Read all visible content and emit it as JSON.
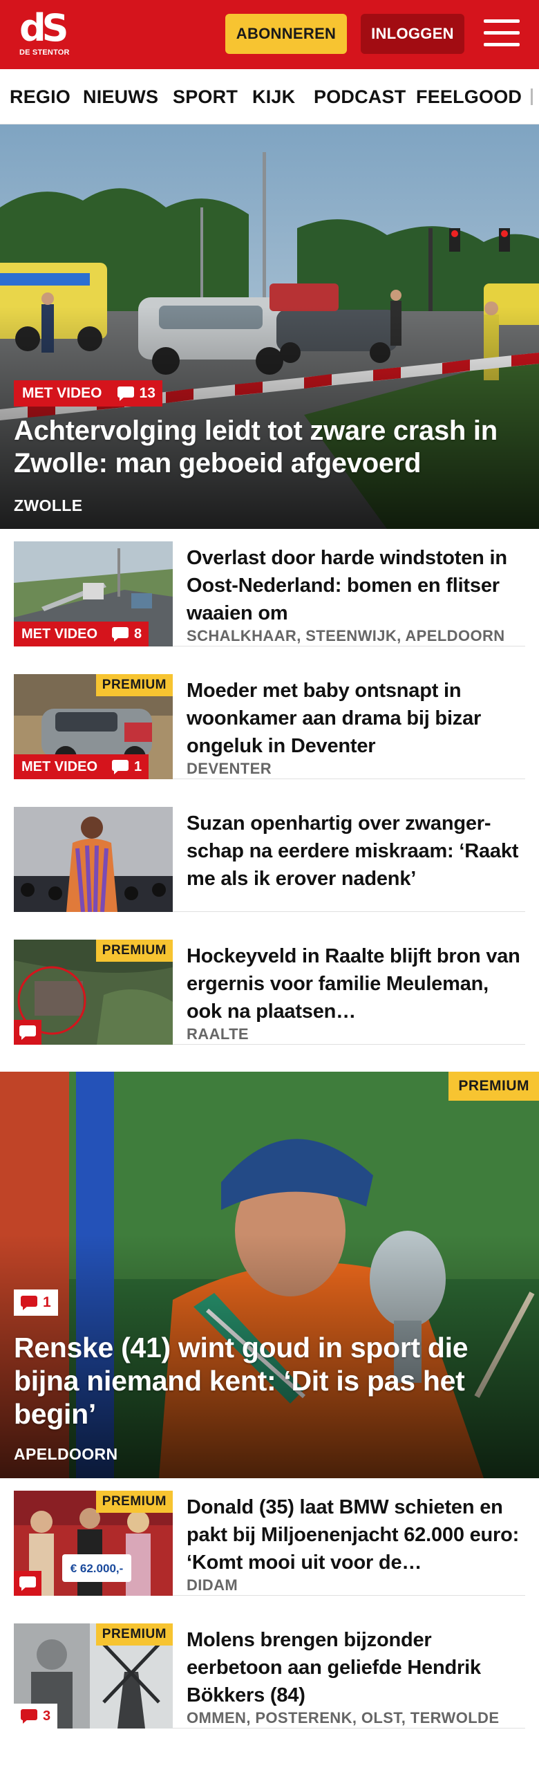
{
  "header": {
    "logo_mark": "dS",
    "logo_text": "DE STENTOR",
    "subscribe_label": "ABONNEREN",
    "login_label": "INLOGGEN",
    "menu_icon": "hamburger-icon",
    "colors": {
      "brand_red": "#d5141c",
      "subscribe_yellow": "#f7c431",
      "login_dark_red": "#a20c12"
    }
  },
  "nav": {
    "items": [
      "REGIO",
      "NIEUWS",
      "SPORT",
      "KIJK",
      "PODCAST",
      "FEELGOOD"
    ]
  },
  "hero": {
    "video_label": "MET VIDEO",
    "comments": "13",
    "title": "Achtervolging leidt tot zware crash in Zwolle: man geboeid afgevoerd",
    "location": "ZWOLLE"
  },
  "articles": [
    {
      "video_label": "MET VIDEO",
      "comments": "8",
      "title": "Overlast door harde windstoten in Oost-Nederland: bomen en flitser waaien om",
      "location": "SCHALKHAAR, STEENWIJK, APELDOORN"
    },
    {
      "premium_label": "PREMIUM",
      "video_label": "MET VIDEO",
      "comments": "1",
      "title": "Moeder met baby ontsnapt in woonkamer aan drama bij bizar ongeluk in Deventer",
      "location": "DEVENTER"
    },
    {
      "title": "Suzan openhartig over zwanger-schap na eerdere miskraam: ‘Raakt me als ik erover nadenk’"
    },
    {
      "premium_label": "PREMIUM",
      "title": "Hockeyveld in Raalte blijft bron van ergernis voor familie Meuleman, ook na plaatsen…",
      "location": "RAALTE"
    }
  ],
  "feature": {
    "premium_label": "PREMIUM",
    "comments": "1",
    "title": "Renske (41) wint goud in sport die bijna niemand kent: ‘Dit is pas het begin’",
    "location": "APELDOORN"
  },
  "articles_bottom": [
    {
      "premium_label": "PREMIUM",
      "thumb_text": "€ 62.000,-",
      "title": "Donald (35) laat BMW schieten en pakt bij Miljoenenjacht 62.000 euro: ‘Komt mooi uit voor de…",
      "location": "DIDAM"
    },
    {
      "premium_label": "PREMIUM",
      "comments": "3",
      "title": "Molens brengen bijzonder eerbetoon aan geliefde Hendrik Bökkers (84)",
      "location": "OMMEN, POSTERENK, OLST, TERWOLDE"
    }
  ]
}
